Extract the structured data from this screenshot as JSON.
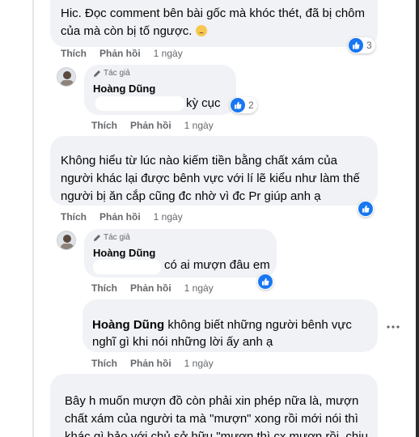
{
  "comments": [
    {
      "lines": [
        "Hic. Đọc comment bên bài gốc mà khóc thét, đã bị chôm",
        "của mà còn bị tố ngược."
      ],
      "actions": {
        "like": "Thích",
        "reply": "Phản hồi",
        "time": "1 ngày"
      },
      "reactions": "3"
    },
    {
      "author_tag": "Tác giả",
      "name": "Hoàng Dũng",
      "text": "kỳ cục",
      "actions": {
        "like": "Thích",
        "reply": "Phản hồi",
        "time": "1 ngày"
      },
      "reactions": "2"
    },
    {
      "lines": [
        "Không hiểu từ lúc nào kiếm tiền bằng chất xám của",
        "người khác lại được bênh vực với lí lẽ kiểu như làm thế",
        "người bị ăn cắp cũng đc nhờ vì đc Pr giúp anh ạ"
      ],
      "actions": {
        "like": "Thích",
        "reply": "Phản hồi",
        "time": "1 ngày"
      }
    },
    {
      "author_tag": "Tác giả",
      "name": "Hoàng Dũng",
      "text": "có ai mượn đâu em",
      "actions": {
        "like": "Thích",
        "reply": "Phản hồi",
        "time": "1 ngày"
      }
    },
    {
      "mention": "Hoàng Dũng",
      "text_first": "không biết những người bênh vực",
      "text_second": "nghĩ gì khi nói những lời ấy anh ạ",
      "actions": {
        "like": "Thích",
        "reply": "Phản hồi",
        "time": "1 ngày"
      }
    },
    {
      "lines": [
        "Bây h muốn mượn đồ còn phải xin phép nữa là, mượn",
        "chất xám của người ta mà \"mượn\" xong rồi mới nói thì",
        "khác gì bảo với chủ sở hữu \"mượn thì cx mượn rồi, chịu"
      ]
    }
  ],
  "icons": {
    "like": "like-thumb-icon",
    "author": "pencil-icon",
    "more": "more-options-icon",
    "emoji": "sad-face-emoji"
  },
  "colors": {
    "bubble": "#f0f2f5",
    "like_blue": "#1877f2",
    "secondary_text": "#65676b"
  }
}
